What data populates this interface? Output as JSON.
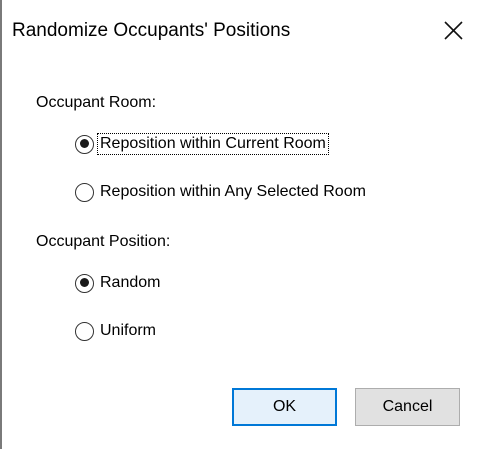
{
  "dialog": {
    "title": "Randomize Occupants' Positions",
    "close_icon": "close-x-icon"
  },
  "occupant_room": {
    "label": "Occupant Room:",
    "options": [
      {
        "label": "Reposition within Current Room",
        "checked": true,
        "focused": true
      },
      {
        "label": "Reposition within Any Selected Room",
        "checked": false,
        "focused": false
      }
    ]
  },
  "occupant_position": {
    "label": "Occupant Position:",
    "options": [
      {
        "label": "Random",
        "checked": true
      },
      {
        "label": "Uniform",
        "checked": false
      }
    ]
  },
  "buttons": {
    "ok_label": "OK",
    "cancel_label": "Cancel"
  },
  "colors": {
    "default_button_border": "#0078d7",
    "default_button_fill": "#e5f1fb",
    "button_fill": "#e1e1e1"
  }
}
